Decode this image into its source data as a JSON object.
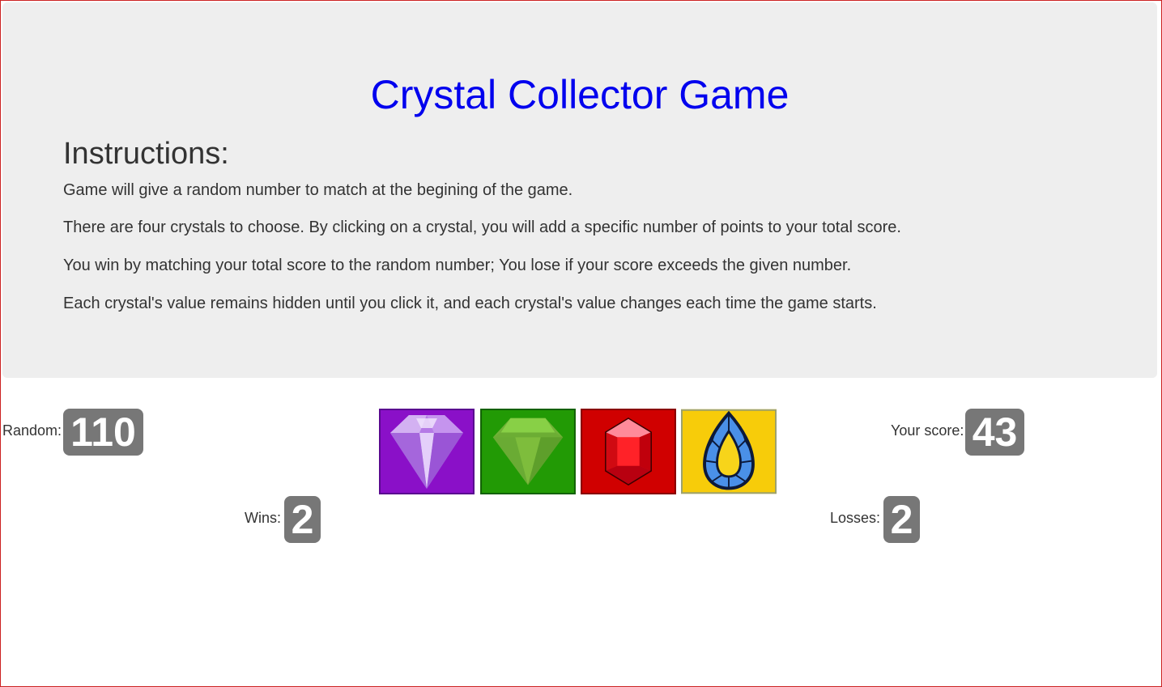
{
  "game": {
    "title": "Crystal Collector Game"
  },
  "instructions": {
    "heading": "Instructions:",
    "lines": [
      "Game will give a random number to match at the begining of the game.",
      "There are four crystals to choose. By clicking on a crystal, you will add a specific number of points to your total score.",
      "You win by matching your total score to the random number; You lose if your score exceeds the given number.",
      "Each crystal's value remains hidden until you click it, and each crystal's value changes each time the game starts."
    ]
  },
  "stats": {
    "random_label": "Random:",
    "random_value": "110",
    "score_label": "Your score:",
    "score_value": "43",
    "wins_label": "Wins:",
    "wins_value": "2",
    "losses_label": "Losses:",
    "losses_value": "2"
  },
  "crystals": [
    {
      "name": "purple-diamond",
      "color": "#8a10c8"
    },
    {
      "name": "green-gem",
      "color": "#229a05"
    },
    {
      "name": "red-ruby",
      "color": "#d00000"
    },
    {
      "name": "blue-sapphire",
      "color": "#f7cc0a"
    }
  ],
  "colors": {
    "title": "#0000ee",
    "jumbotron_bg": "#eeeeee",
    "badge_bg": "#777777",
    "frame_border": "#cc2222"
  }
}
